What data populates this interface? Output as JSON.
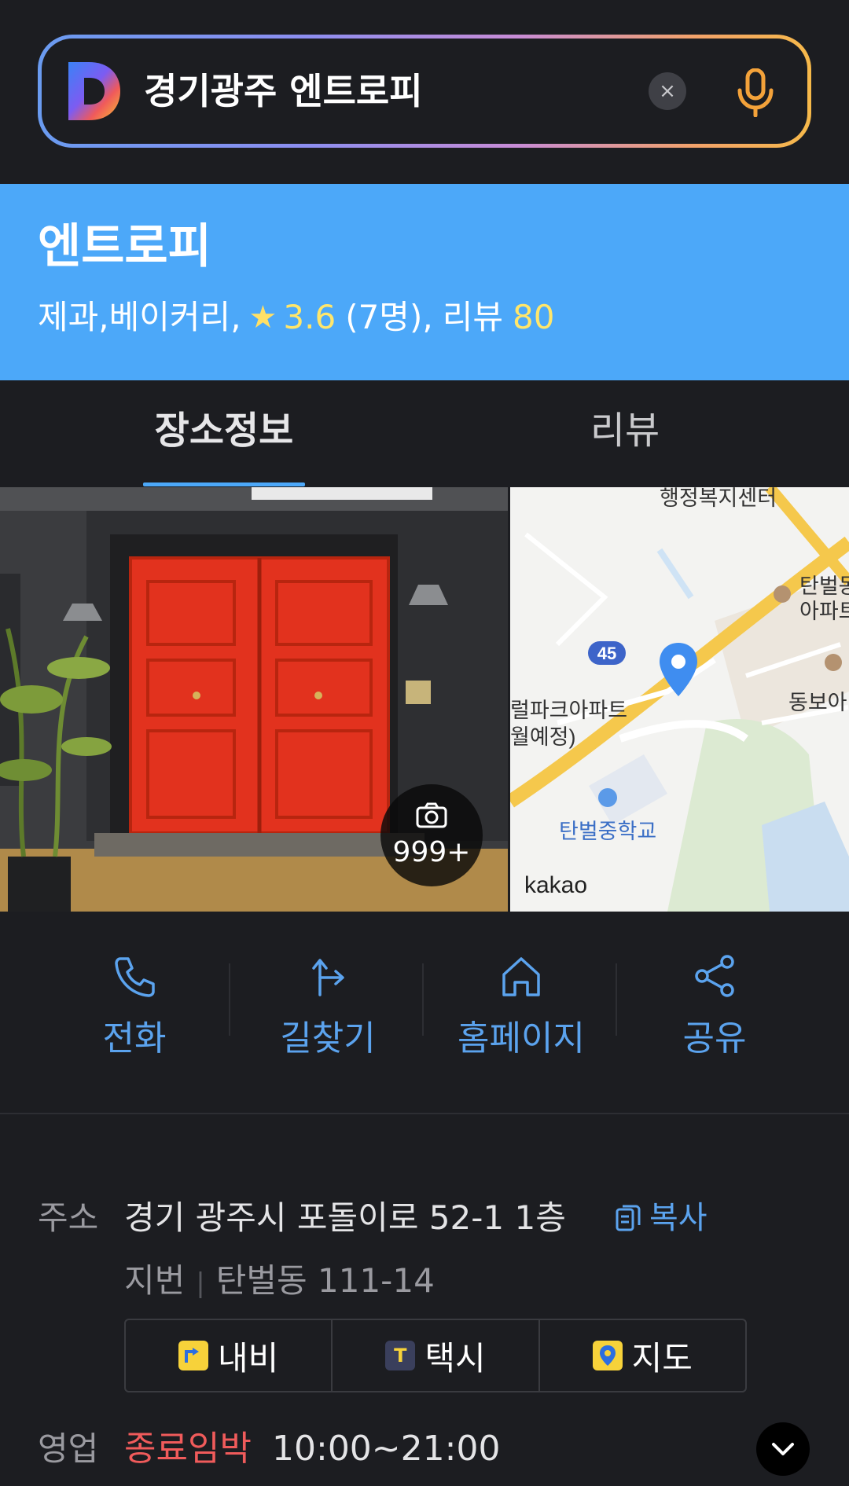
{
  "search": {
    "query": "경기광주 엔트로피",
    "clear_icon": "×"
  },
  "place": {
    "name": "엔트로피",
    "category": "제과,베이커리,",
    "rating": "3.6",
    "rating_count": "(7명),",
    "review_label": "리뷰",
    "review_count": "80"
  },
  "tabs": [
    {
      "label": "장소정보",
      "active": true
    },
    {
      "label": "리뷰",
      "active": false
    }
  ],
  "photo": {
    "count": "999+"
  },
  "map": {
    "labels": [
      "행정복지센터",
      "탄벌동",
      "아파트",
      "동보아",
      "럴파크아파트",
      "월예정)",
      "탄벌중학교",
      "kakao"
    ],
    "road_number": "45"
  },
  "actions": [
    {
      "label": "전화",
      "icon": "phone-icon"
    },
    {
      "label": "길찾기",
      "icon": "directions-icon"
    },
    {
      "label": "홈페이지",
      "icon": "home-icon"
    },
    {
      "label": "공유",
      "icon": "share-icon"
    }
  ],
  "info": {
    "address_label": "주소",
    "address": "경기 광주시 포돌이로 52-1 1층",
    "copy_label": "복사",
    "lot_label": "지번",
    "lot_address": "탄벌동 111-14",
    "nav_buttons": [
      {
        "label": "내비"
      },
      {
        "label": "택시"
      },
      {
        "label": "지도"
      }
    ],
    "hours_label": "영업",
    "hours_status": "종료임박",
    "hours": "10:00~21:00"
  },
  "colors": {
    "accent": "#4ca8f9",
    "link": "#5ba3ee",
    "warning": "#f05b5b",
    "highlight": "#ffe66b"
  }
}
